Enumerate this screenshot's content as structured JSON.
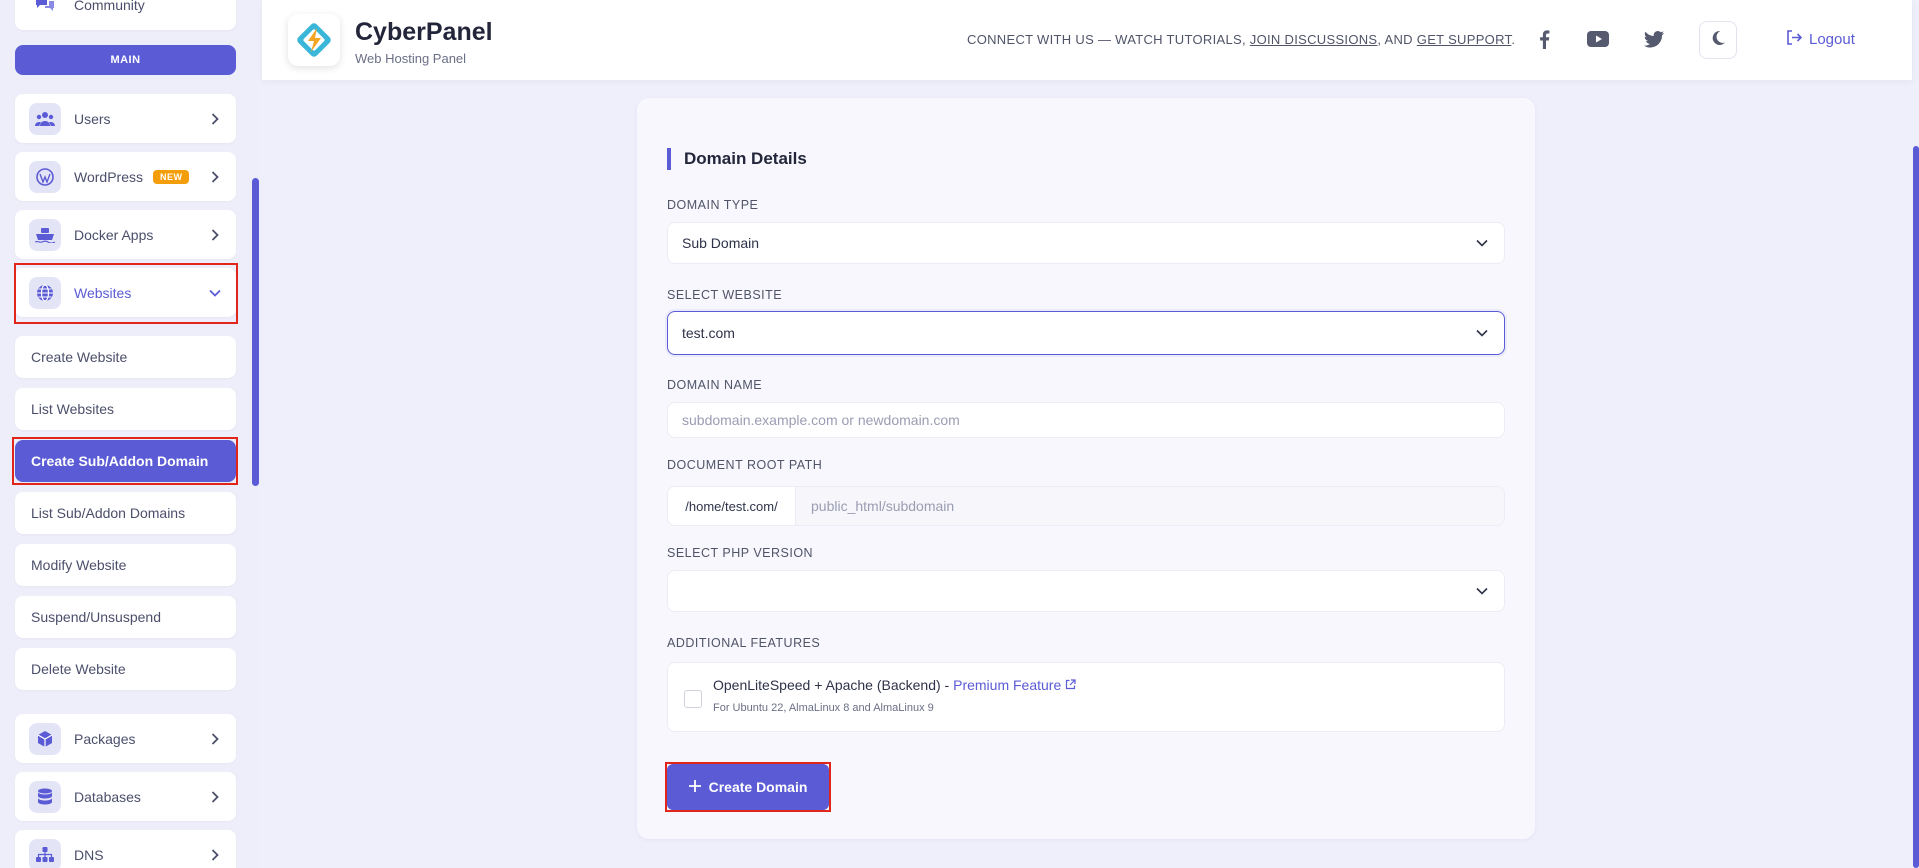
{
  "sidebar": {
    "top_item": "Community",
    "section_label": "MAIN",
    "items": [
      {
        "label": "Users",
        "icon": "users-icon"
      },
      {
        "label": "WordPress",
        "icon": "wordpress-icon",
        "badge": "NEW"
      },
      {
        "label": "Docker Apps",
        "icon": "docker-icon"
      },
      {
        "label": "Websites",
        "icon": "globe-icon",
        "expanded": true
      },
      {
        "label": "Packages",
        "icon": "package-icon"
      },
      {
        "label": "Databases",
        "icon": "database-icon"
      },
      {
        "label": "DNS",
        "icon": "dns-icon"
      }
    ],
    "sub_items": [
      {
        "label": "Create Website"
      },
      {
        "label": "List Websites"
      },
      {
        "label": "Create Sub/Addon Domain",
        "current": true
      },
      {
        "label": "List Sub/Addon Domains"
      },
      {
        "label": "Modify Website"
      },
      {
        "label": "Suspend/Unsuspend"
      },
      {
        "label": "Delete Website"
      }
    ]
  },
  "header": {
    "title": "CyberPanel",
    "subtitle": "Web Hosting Panel",
    "connect_prefix": "CONNECT WITH US — WATCH TUTORIALS, ",
    "join_link": "JOIN DISCUSSIONS",
    "connect_mid": ", AND ",
    "support_link": "GET SUPPORT",
    "connect_suffix": ".",
    "social": [
      "facebook-icon",
      "youtube-icon",
      "twitter-icon"
    ],
    "logout_label": "Logout"
  },
  "form": {
    "section_title": "Domain Details",
    "domain_type_label": "DOMAIN TYPE",
    "domain_type_value": "Sub Domain",
    "select_website_label": "SELECT WEBSITE",
    "select_website_value": "test.com",
    "domain_name_label": "DOMAIN NAME",
    "domain_name_placeholder": "subdomain.example.com or newdomain.com",
    "doc_root_label": "DOCUMENT ROOT PATH",
    "doc_root_prefix": "/home/test.com/",
    "doc_root_placeholder": "public_html/subdomain",
    "php_label": "SELECT PHP VERSION",
    "php_value": "",
    "features_label": "ADDITIONAL FEATURES",
    "feature_title": "OpenLiteSpeed + Apache (Backend) - ",
    "feature_premium": "Premium Feature",
    "feature_sub": "For Ubuntu 22, AlmaLinux 8 and AlmaLinux 9",
    "submit_label": "Create Domain"
  },
  "colors": {
    "accent": "#5b5bd6",
    "highlight": "#e0261b",
    "badge": "#f59e0b"
  }
}
